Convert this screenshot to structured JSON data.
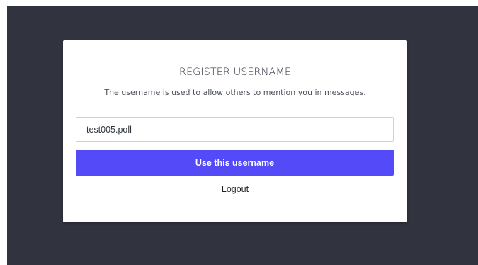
{
  "register": {
    "title": "REGISTER USERNAME",
    "description": "The username is used to allow others to mention you in messages.",
    "username_value": "test005.poll",
    "submit_label": "Use this username",
    "logout_label": "Logout"
  },
  "colors": {
    "background": "#31333f",
    "primary": "#554af7",
    "card": "#ffffff"
  }
}
